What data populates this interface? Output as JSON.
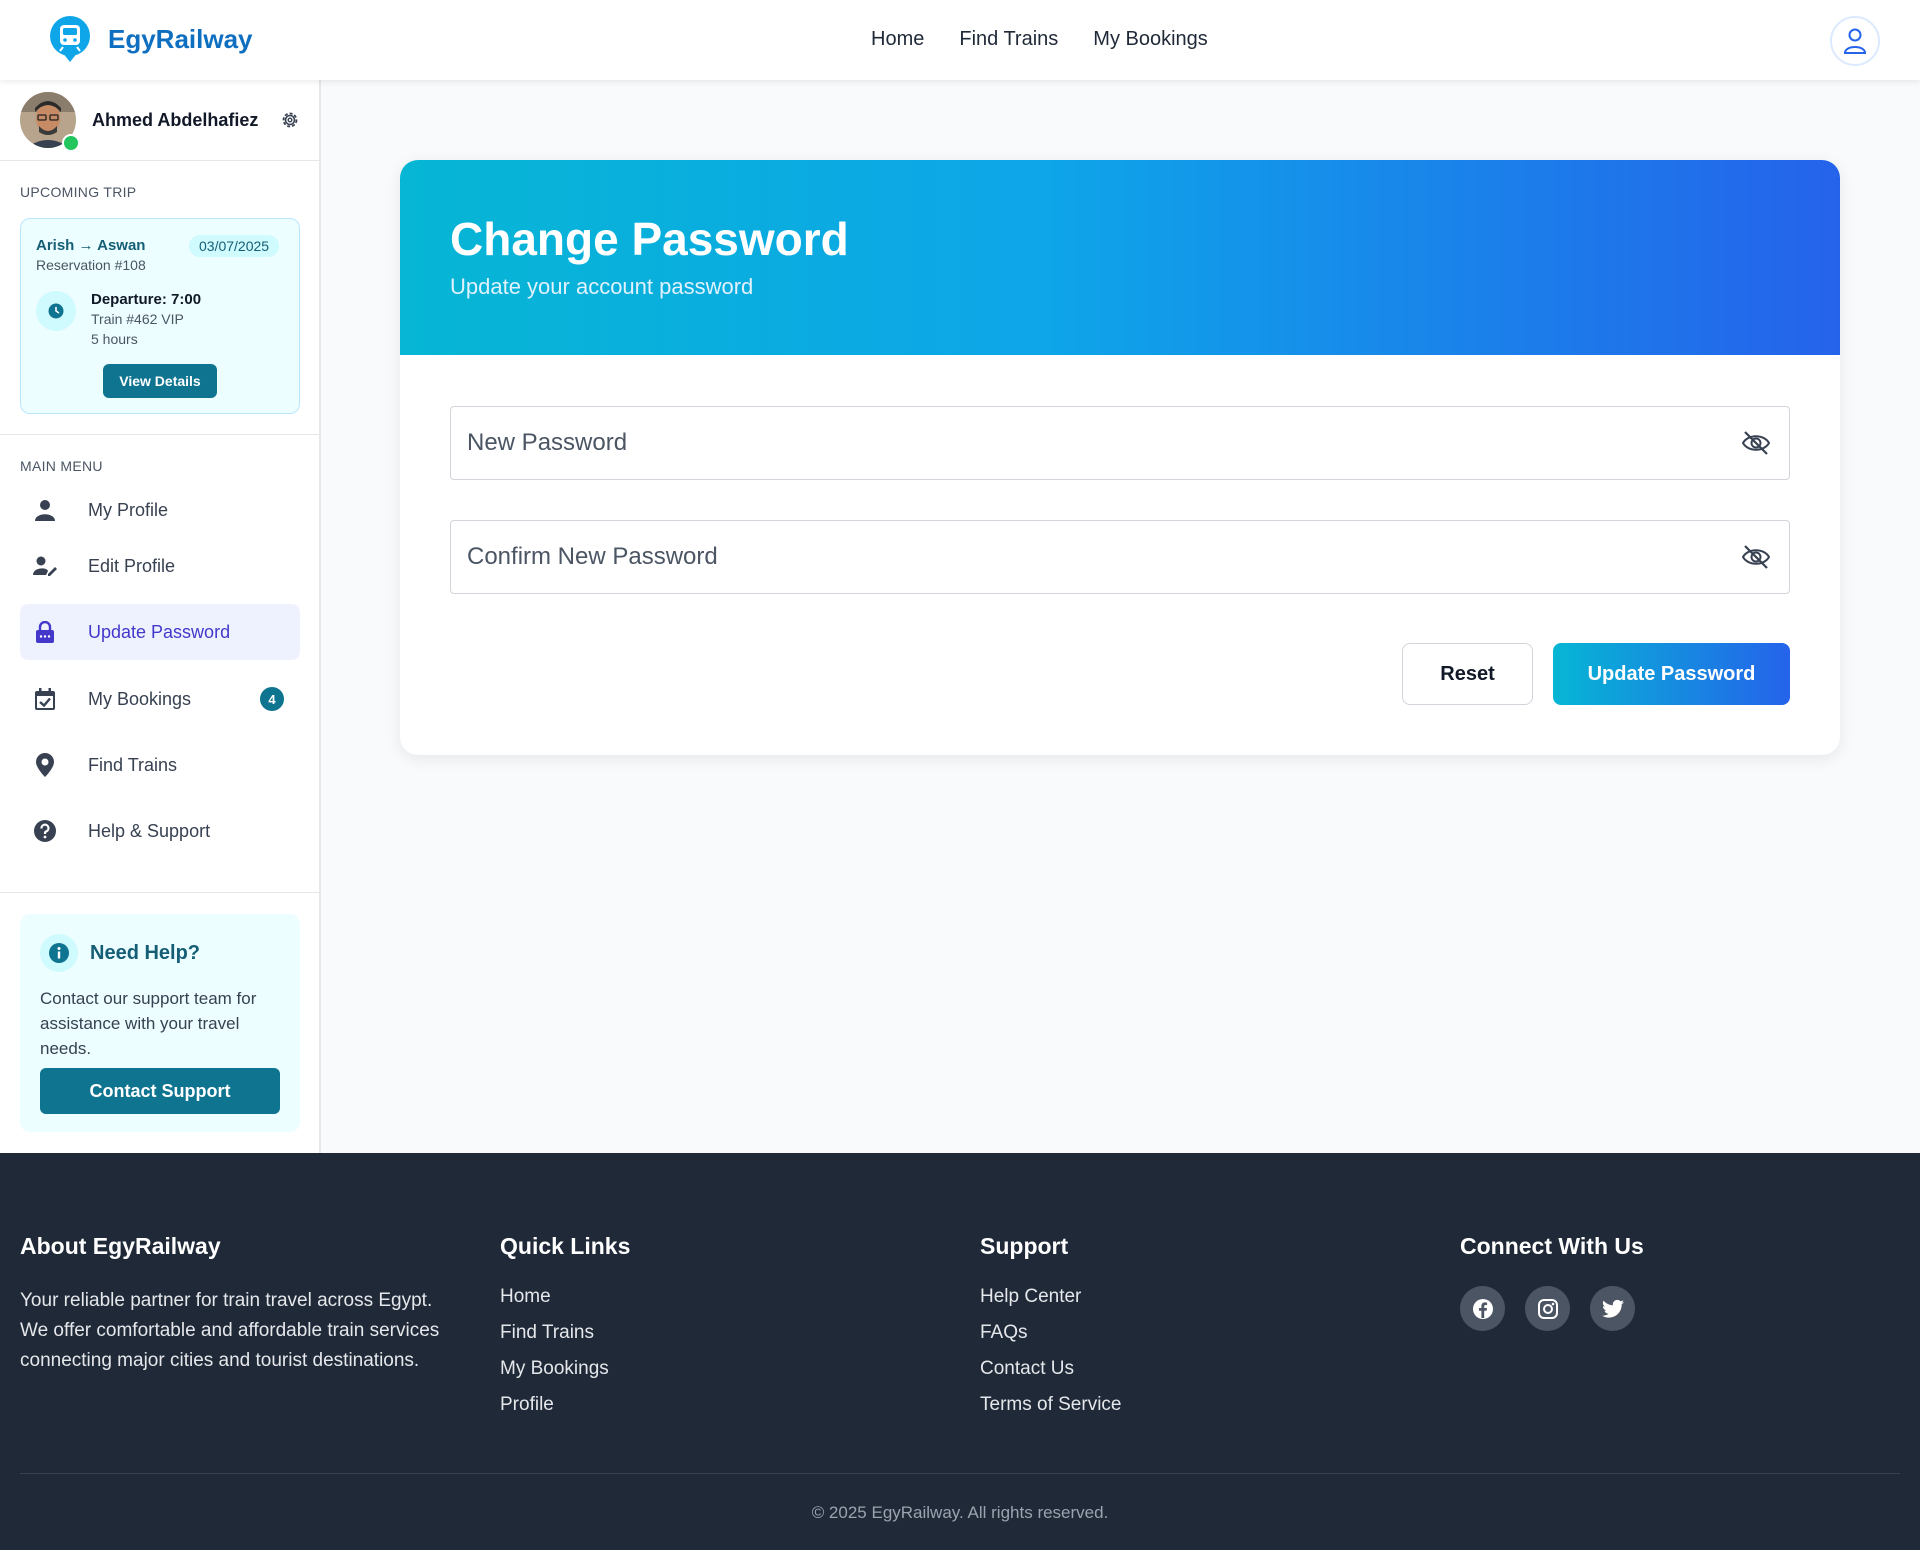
{
  "app": {
    "name": "EgyRailway"
  },
  "nav": {
    "home": "Home",
    "find_trains": "Find Trains",
    "my_bookings": "My Bookings"
  },
  "user": {
    "name": "Ahmed Abdelhafiez"
  },
  "upcoming": {
    "label": "UPCOMING TRIP",
    "route": "Arish → Aswan",
    "reservation": "Reservation #108",
    "date": "03/07/2025",
    "departure": "Departure: 7:00",
    "train": "Train #462 VIP",
    "duration": "5 hours",
    "button": "View Details"
  },
  "menu": {
    "label": "MAIN MENU",
    "items": [
      {
        "label": "My Profile",
        "icon": "user-icon"
      },
      {
        "label": "Edit Profile",
        "icon": "user-edit-icon"
      },
      {
        "label": "Update Password",
        "icon": "lock-icon",
        "active": true
      },
      {
        "label": "My Bookings",
        "icon": "calendar-check-icon",
        "badge": "4"
      },
      {
        "label": "Find Trains",
        "icon": "map-pin-icon"
      },
      {
        "label": "Help & Support",
        "icon": "question-circle-icon"
      }
    ]
  },
  "help": {
    "title": "Need Help?",
    "text": "Contact our support team for assistance with your travel needs.",
    "button": "Contact Support"
  },
  "card": {
    "title": "Change Password",
    "subtitle": "Update your account password",
    "new_password_placeholder": "New Password",
    "confirm_password_placeholder": "Confirm New Password",
    "reset": "Reset",
    "submit": "Update Password"
  },
  "footer": {
    "about": {
      "title": "About EgyRailway",
      "text": "Your reliable partner for train travel across Egypt. We offer comfortable and affordable train services connecting major cities and tourist destinations."
    },
    "quick_links": {
      "title": "Quick Links",
      "items": [
        "Home",
        "Find Trains",
        "My Bookings",
        "Profile"
      ]
    },
    "support": {
      "title": "Support",
      "items": [
        "Help Center",
        "FAQs",
        "Contact Us",
        "Terms of Service"
      ]
    },
    "connect": {
      "title": "Connect With Us",
      "icons": [
        "facebook-icon",
        "instagram-icon",
        "twitter-icon"
      ]
    },
    "copyright": "© 2025 EgyRailway. All rights reserved."
  },
  "colors": {
    "primary": "#0e7490",
    "accent_start": "#06b6d4",
    "accent_end": "#2563eb",
    "footer_bg": "#1f2937"
  }
}
